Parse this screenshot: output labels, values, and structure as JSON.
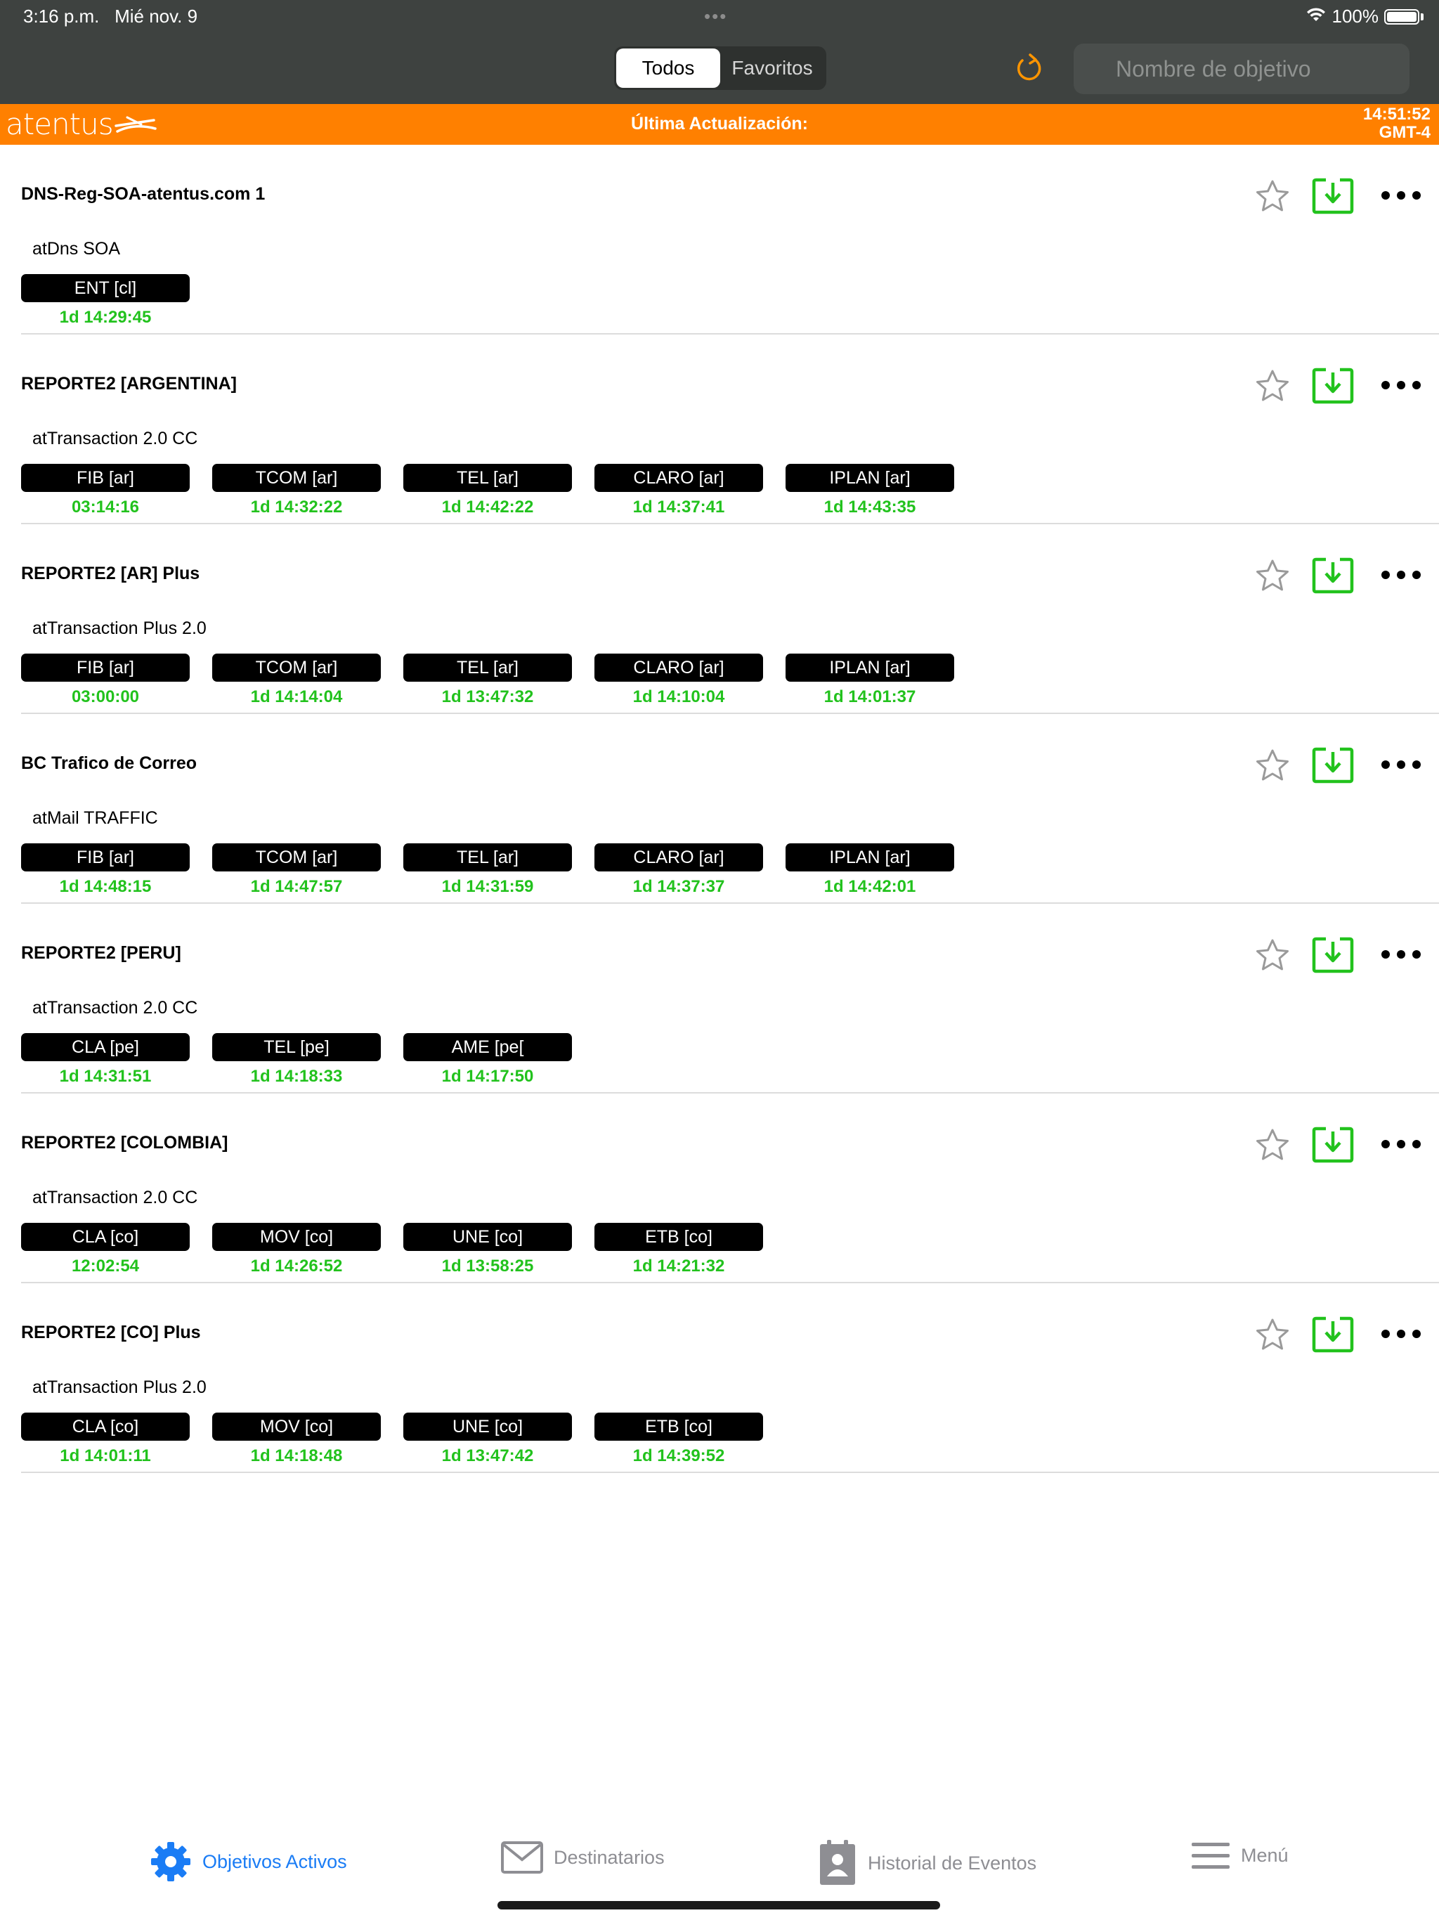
{
  "status": {
    "time": "3:16 p.m.",
    "date": "Mié nov. 9",
    "battery": "100%"
  },
  "nav": {
    "segments": [
      {
        "label": "Todos",
        "active": true
      },
      {
        "label": "Favoritos",
        "active": false
      }
    ],
    "search_placeholder": "Nombre de objetivo"
  },
  "banner": {
    "logo": "atentus",
    "title": "Última Actualización:",
    "time": "14:51:52",
    "timezone": "GMT-4"
  },
  "colors": {
    "accent": "#ff8000",
    "ok_green": "#22c21d",
    "tab_active": "#1a7cf5",
    "dark_bar": "#3e4240"
  },
  "objectives": [
    {
      "title": "DNS-Reg-SOA-atentus.com 1",
      "subtitle": "atDns SOA",
      "nodes": [
        {
          "label": "ENT [cl]",
          "time": "1d 14:29:45"
        }
      ]
    },
    {
      "title": "REPORTE2 [ARGENTINA]",
      "subtitle": "atTransaction 2.0 CC",
      "nodes": [
        {
          "label": "FIB [ar]",
          "time": "03:14:16"
        },
        {
          "label": "TCOM [ar]",
          "time": "1d 14:32:22"
        },
        {
          "label": "TEL [ar]",
          "time": "1d 14:42:22"
        },
        {
          "label": "CLARO [ar]",
          "time": "1d 14:37:41"
        },
        {
          "label": "IPLAN [ar]",
          "time": "1d 14:43:35"
        }
      ]
    },
    {
      "title": "REPORTE2 [AR] Plus",
      "subtitle": "atTransaction Plus 2.0",
      "nodes": [
        {
          "label": "FIB [ar]",
          "time": "03:00:00"
        },
        {
          "label": "TCOM [ar]",
          "time": "1d 14:14:04"
        },
        {
          "label": "TEL [ar]",
          "time": "1d 13:47:32"
        },
        {
          "label": "CLARO [ar]",
          "time": "1d 14:10:04"
        },
        {
          "label": "IPLAN [ar]",
          "time": "1d 14:01:37"
        }
      ]
    },
    {
      "title": "BC Trafico de Correo",
      "subtitle": "atMail TRAFFIC",
      "nodes": [
        {
          "label": "FIB [ar]",
          "time": "1d 14:48:15"
        },
        {
          "label": "TCOM [ar]",
          "time": "1d 14:47:57"
        },
        {
          "label": "TEL [ar]",
          "time": "1d 14:31:59"
        },
        {
          "label": "CLARO [ar]",
          "time": "1d 14:37:37"
        },
        {
          "label": "IPLAN [ar]",
          "time": "1d 14:42:01"
        }
      ]
    },
    {
      "title": "REPORTE2 [PERU]",
      "subtitle": "atTransaction 2.0 CC",
      "nodes": [
        {
          "label": "CLA [pe]",
          "time": "1d 14:31:51"
        },
        {
          "label": "TEL [pe]",
          "time": "1d 14:18:33"
        },
        {
          "label": "AME [pe[",
          "time": "1d 14:17:50"
        }
      ]
    },
    {
      "title": "REPORTE2 [COLOMBIA]",
      "subtitle": "atTransaction 2.0 CC",
      "nodes": [
        {
          "label": "CLA [co]",
          "time": "12:02:54"
        },
        {
          "label": "MOV [co]",
          "time": "1d 14:26:52"
        },
        {
          "label": "UNE [co]",
          "time": "1d 13:58:25"
        },
        {
          "label": "ETB [co]",
          "time": "1d 14:21:32"
        }
      ]
    },
    {
      "title": "REPORTE2 [CO] Plus",
      "subtitle": "atTransaction Plus 2.0",
      "nodes": [
        {
          "label": "CLA [co]",
          "time": "1d 14:01:11"
        },
        {
          "label": "MOV [co]",
          "time": "1d 14:18:48"
        },
        {
          "label": "UNE [co]",
          "time": "1d 13:47:42"
        },
        {
          "label": "ETB [co]",
          "time": "1d 14:39:52"
        }
      ]
    }
  ],
  "tabbar": {
    "items": [
      {
        "label": "Objetivos Activos",
        "icon": "gear-icon",
        "active": true
      },
      {
        "label": "Destinatarios",
        "icon": "envelope-icon",
        "active": false
      },
      {
        "label": "Historial de Eventos",
        "icon": "contact-book-icon",
        "active": false
      },
      {
        "label": "Menú",
        "icon": "hamburger-icon",
        "active": false
      }
    ]
  }
}
